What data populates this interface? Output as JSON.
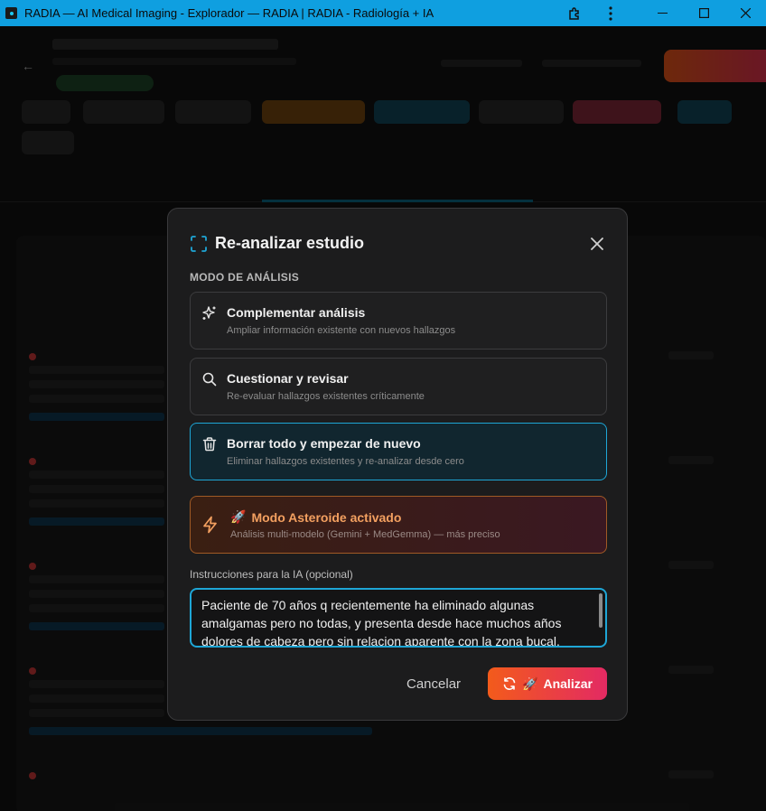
{
  "window": {
    "title": "RADIA — AI Medical Imaging - Explorador — RADIA | RADIA - Radiología + IA"
  },
  "modal": {
    "title": "Re-analizar estudio",
    "section_label": "MODO DE ANÁLISIS",
    "options": [
      {
        "title": "Complementar análisis",
        "subtitle": "Ampliar información existente con nuevos hallazgos",
        "icon": "sparkles-icon",
        "selected": false
      },
      {
        "title": "Cuestionar y revisar",
        "subtitle": "Re-evaluar hallazgos existentes críticamente",
        "icon": "search-icon",
        "selected": false
      },
      {
        "title": "Borrar todo y empezar de nuevo",
        "subtitle": "Eliminar hallazgos existentes y re-analizar desde cero",
        "icon": "trash-icon",
        "selected": true
      }
    ],
    "asteroid": {
      "emoji": "🚀",
      "title": "Modo Asteroide activado",
      "subtitle": "Análisis multi-modelo (Gemini + MedGemma) — más preciso"
    },
    "instructions_label": "Instrucciones para la IA (opcional)",
    "instructions_value": "Paciente de 70 años q recientemente ha eliminado algunas amalgamas pero no todas, y presenta desde hace muchos años dolores de cabeza pero sin relacion aparente con la zona bucal.",
    "cancel_label": "Cancelar",
    "analyze_label": "Analizar",
    "analyze_emoji": "🚀"
  },
  "colors": {
    "titlebar": "#0f9fe0",
    "accent": "#1ea6d6",
    "asteroid_border": "#a05a25",
    "analyze_start": "#f35b1b",
    "analyze_end": "#e32a63"
  }
}
